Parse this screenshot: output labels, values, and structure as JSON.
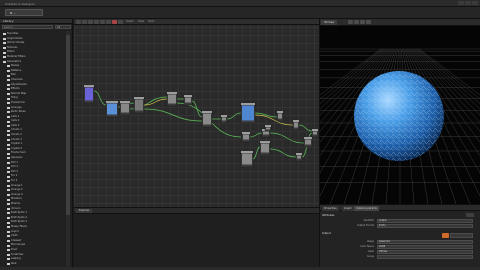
{
  "window": {
    "title": "Substance Designer"
  },
  "menubar": {
    "pill_label": "N  ..."
  },
  "library": {
    "header": "Library",
    "search_placeholder": "Search",
    "filter_label": "All",
    "items": [
      {
        "label": "Favorites",
        "indent": 0
      },
      {
        "label": "Graph Items",
        "indent": 0
      },
      {
        "label": "Atomic Nodes",
        "indent": 0
      },
      {
        "label": "Textures",
        "indent": 0
      },
      {
        "label": "Filters",
        "indent": 0
      },
      {
        "label": "Material Filters",
        "indent": 0
      },
      {
        "label": "Generators",
        "indent": 0
      },
      {
        "label": "Noises",
        "indent": 1
      },
      {
        "label": "Patterns",
        "indent": 1
      },
      {
        "label": "Blur",
        "indent": 1
      },
      {
        "label": "Channels",
        "indent": 1
      },
      {
        "label": "Adjustments",
        "indent": 1
      },
      {
        "label": "Effects",
        "indent": 1
      },
      {
        "label": "Normal Map",
        "indent": 1
      },
      {
        "label": "Tiling",
        "indent": 1
      },
      {
        "label": "Transforms",
        "indent": 1
      },
      {
        "label": "Grunges",
        "indent": 1
      },
      {
        "label": "Perlin Noise",
        "indent": 1
      },
      {
        "label": "Cells 1",
        "indent": 1
      },
      {
        "label": "Cells 2",
        "indent": 1
      },
      {
        "label": "Cells 3",
        "indent": 1
      },
      {
        "label": "Clouds 1",
        "indent": 1
      },
      {
        "label": "Clouds 2",
        "indent": 1
      },
      {
        "label": "Clouds 3",
        "indent": 1
      },
      {
        "label": "Crystal 1",
        "indent": 1
      },
      {
        "label": "Crystal 2",
        "indent": 1
      },
      {
        "label": "Fractal Sum",
        "indent": 1
      },
      {
        "label": "Gaussian",
        "indent": 1
      },
      {
        "label": "Dirt 1",
        "indent": 1
      },
      {
        "label": "Dirt 2",
        "indent": 1
      },
      {
        "label": "Dirt 3",
        "indent": 1
      },
      {
        "label": "Fur 1",
        "indent": 1
      },
      {
        "label": "Fur 2",
        "indent": 1
      },
      {
        "label": "Grunge 1",
        "indent": 1
      },
      {
        "label": "Grunge 2",
        "indent": 1
      },
      {
        "label": "Grunge 3",
        "indent": 1
      },
      {
        "label": "Moisture",
        "indent": 1
      },
      {
        "label": "Plasma",
        "indent": 1
      },
      {
        "label": "Voronoi",
        "indent": 1
      },
      {
        "label": "BnW Spots 1",
        "indent": 1
      },
      {
        "label": "BnW Spots 2",
        "indent": 1
      },
      {
        "label": "BnW Spots 3",
        "indent": 1
      },
      {
        "label": "Messy Fibers",
        "indent": 1
      },
      {
        "label": "Liquid",
        "indent": 1
      },
      {
        "label": "Cloth",
        "indent": 1
      },
      {
        "label": "Creased",
        "indent": 1
      },
      {
        "label": "Microscope",
        "indent": 1
      },
      {
        "label": "Dust",
        "indent": 1
      },
      {
        "label": "Scratches",
        "indent": 1
      },
      {
        "label": "Leaking",
        "indent": 1
      },
      {
        "label": "Rust",
        "indent": 1
      }
    ]
  },
  "graph": {
    "toolbar_labels": [
      "Graph",
      "View",
      "Tools"
    ]
  },
  "lower_panel": {
    "tabs": [
      "Explorer"
    ]
  },
  "view3d": {
    "tab_label": "3D View",
    "accent_grid": "#3a3a3a",
    "sphere_color": "#3f8fd8"
  },
  "properties": {
    "tabs": [
      "Properties",
      "Graph",
      "Instance params"
    ],
    "sections": [
      "Attributes",
      "Output"
    ],
    "rows": [
      {
        "label": "Identifier",
        "value": "output"
      },
      {
        "label": "Output Format",
        "value": "8 bits"
      },
      {
        "label": "Usage",
        "value": "baseColor"
      },
      {
        "label": "Color Space",
        "value": "sRGB"
      },
      {
        "label": "Label",
        "value": "Diffuse"
      },
      {
        "label": "Group",
        "value": ""
      }
    ]
  },
  "colors": {
    "link_green": "#5cc35c",
    "link_yellow": "#d9c94a",
    "node_header": "#8a8a8a",
    "node_body": "#3b3b3b"
  }
}
